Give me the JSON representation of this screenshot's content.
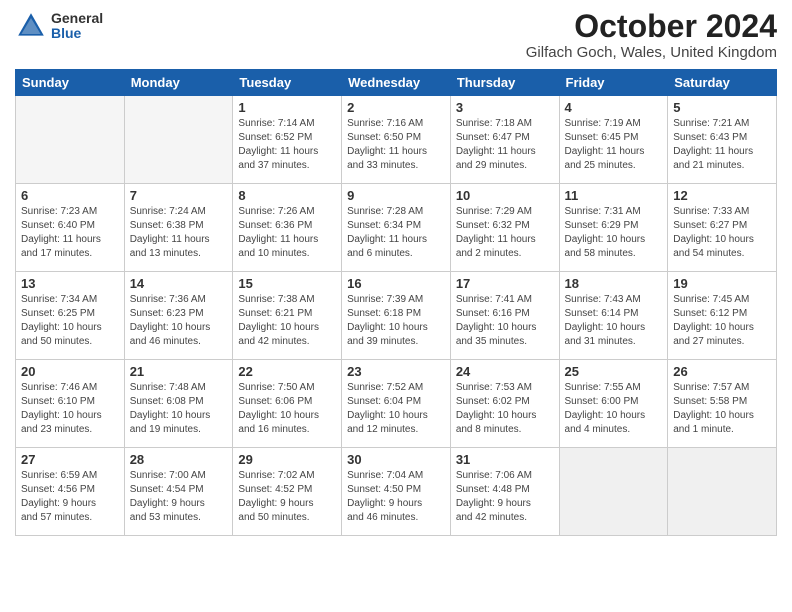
{
  "logo": {
    "general": "General",
    "blue": "Blue"
  },
  "title": "October 2024",
  "location": "Gilfach Goch, Wales, United Kingdom",
  "days_of_week": [
    "Sunday",
    "Monday",
    "Tuesday",
    "Wednesday",
    "Thursday",
    "Friday",
    "Saturday"
  ],
  "weeks": [
    [
      {
        "day": "",
        "info": ""
      },
      {
        "day": "",
        "info": ""
      },
      {
        "day": "1",
        "info": "Sunrise: 7:14 AM\nSunset: 6:52 PM\nDaylight: 11 hours\nand 37 minutes."
      },
      {
        "day": "2",
        "info": "Sunrise: 7:16 AM\nSunset: 6:50 PM\nDaylight: 11 hours\nand 33 minutes."
      },
      {
        "day": "3",
        "info": "Sunrise: 7:18 AM\nSunset: 6:47 PM\nDaylight: 11 hours\nand 29 minutes."
      },
      {
        "day": "4",
        "info": "Sunrise: 7:19 AM\nSunset: 6:45 PM\nDaylight: 11 hours\nand 25 minutes."
      },
      {
        "day": "5",
        "info": "Sunrise: 7:21 AM\nSunset: 6:43 PM\nDaylight: 11 hours\nand 21 minutes."
      }
    ],
    [
      {
        "day": "6",
        "info": "Sunrise: 7:23 AM\nSunset: 6:40 PM\nDaylight: 11 hours\nand 17 minutes."
      },
      {
        "day": "7",
        "info": "Sunrise: 7:24 AM\nSunset: 6:38 PM\nDaylight: 11 hours\nand 13 minutes."
      },
      {
        "day": "8",
        "info": "Sunrise: 7:26 AM\nSunset: 6:36 PM\nDaylight: 11 hours\nand 10 minutes."
      },
      {
        "day": "9",
        "info": "Sunrise: 7:28 AM\nSunset: 6:34 PM\nDaylight: 11 hours\nand 6 minutes."
      },
      {
        "day": "10",
        "info": "Sunrise: 7:29 AM\nSunset: 6:32 PM\nDaylight: 11 hours\nand 2 minutes."
      },
      {
        "day": "11",
        "info": "Sunrise: 7:31 AM\nSunset: 6:29 PM\nDaylight: 10 hours\nand 58 minutes."
      },
      {
        "day": "12",
        "info": "Sunrise: 7:33 AM\nSunset: 6:27 PM\nDaylight: 10 hours\nand 54 minutes."
      }
    ],
    [
      {
        "day": "13",
        "info": "Sunrise: 7:34 AM\nSunset: 6:25 PM\nDaylight: 10 hours\nand 50 minutes."
      },
      {
        "day": "14",
        "info": "Sunrise: 7:36 AM\nSunset: 6:23 PM\nDaylight: 10 hours\nand 46 minutes."
      },
      {
        "day": "15",
        "info": "Sunrise: 7:38 AM\nSunset: 6:21 PM\nDaylight: 10 hours\nand 42 minutes."
      },
      {
        "day": "16",
        "info": "Sunrise: 7:39 AM\nSunset: 6:18 PM\nDaylight: 10 hours\nand 39 minutes."
      },
      {
        "day": "17",
        "info": "Sunrise: 7:41 AM\nSunset: 6:16 PM\nDaylight: 10 hours\nand 35 minutes."
      },
      {
        "day": "18",
        "info": "Sunrise: 7:43 AM\nSunset: 6:14 PM\nDaylight: 10 hours\nand 31 minutes."
      },
      {
        "day": "19",
        "info": "Sunrise: 7:45 AM\nSunset: 6:12 PM\nDaylight: 10 hours\nand 27 minutes."
      }
    ],
    [
      {
        "day": "20",
        "info": "Sunrise: 7:46 AM\nSunset: 6:10 PM\nDaylight: 10 hours\nand 23 minutes."
      },
      {
        "day": "21",
        "info": "Sunrise: 7:48 AM\nSunset: 6:08 PM\nDaylight: 10 hours\nand 19 minutes."
      },
      {
        "day": "22",
        "info": "Sunrise: 7:50 AM\nSunset: 6:06 PM\nDaylight: 10 hours\nand 16 minutes."
      },
      {
        "day": "23",
        "info": "Sunrise: 7:52 AM\nSunset: 6:04 PM\nDaylight: 10 hours\nand 12 minutes."
      },
      {
        "day": "24",
        "info": "Sunrise: 7:53 AM\nSunset: 6:02 PM\nDaylight: 10 hours\nand 8 minutes."
      },
      {
        "day": "25",
        "info": "Sunrise: 7:55 AM\nSunset: 6:00 PM\nDaylight: 10 hours\nand 4 minutes."
      },
      {
        "day": "26",
        "info": "Sunrise: 7:57 AM\nSunset: 5:58 PM\nDaylight: 10 hours\nand 1 minute."
      }
    ],
    [
      {
        "day": "27",
        "info": "Sunrise: 6:59 AM\nSunset: 4:56 PM\nDaylight: 9 hours\nand 57 minutes."
      },
      {
        "day": "28",
        "info": "Sunrise: 7:00 AM\nSunset: 4:54 PM\nDaylight: 9 hours\nand 53 minutes."
      },
      {
        "day": "29",
        "info": "Sunrise: 7:02 AM\nSunset: 4:52 PM\nDaylight: 9 hours\nand 50 minutes."
      },
      {
        "day": "30",
        "info": "Sunrise: 7:04 AM\nSunset: 4:50 PM\nDaylight: 9 hours\nand 46 minutes."
      },
      {
        "day": "31",
        "info": "Sunrise: 7:06 AM\nSunset: 4:48 PM\nDaylight: 9 hours\nand 42 minutes."
      },
      {
        "day": "",
        "info": ""
      },
      {
        "day": "",
        "info": ""
      }
    ]
  ]
}
